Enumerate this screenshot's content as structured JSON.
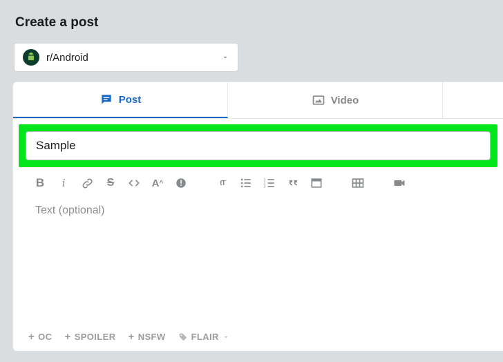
{
  "header": {
    "title": "Create a post"
  },
  "community": {
    "name": "r/Android",
    "icon_label": "android-icon"
  },
  "tabs": {
    "post": "Post",
    "video": "Video"
  },
  "form": {
    "title_value": "Sample",
    "body_placeholder": "Text (optional)"
  },
  "tags": {
    "oc": "OC",
    "spoiler": "SPOILER",
    "nsfw": "NSFW",
    "flair": "FLAIR"
  },
  "toolbar": {
    "bold": "B",
    "italic": "i",
    "strike": "S",
    "super": "A",
    "super_sym": "^",
    "heading": "tT"
  }
}
